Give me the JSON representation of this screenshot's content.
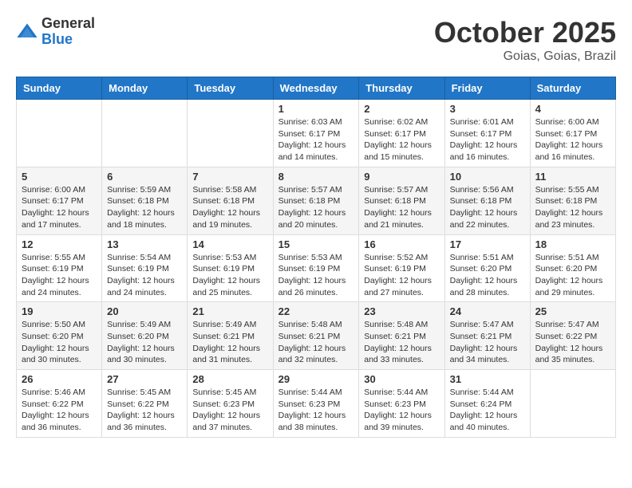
{
  "header": {
    "logo_general": "General",
    "logo_blue": "Blue",
    "title": "October 2025",
    "subtitle": "Goias, Goias, Brazil"
  },
  "weekdays": [
    "Sunday",
    "Monday",
    "Tuesday",
    "Wednesday",
    "Thursday",
    "Friday",
    "Saturday"
  ],
  "weeks": [
    [
      {
        "day": "",
        "info": ""
      },
      {
        "day": "",
        "info": ""
      },
      {
        "day": "",
        "info": ""
      },
      {
        "day": "1",
        "info": "Sunrise: 6:03 AM\nSunset: 6:17 PM\nDaylight: 12 hours\nand 14 minutes."
      },
      {
        "day": "2",
        "info": "Sunrise: 6:02 AM\nSunset: 6:17 PM\nDaylight: 12 hours\nand 15 minutes."
      },
      {
        "day": "3",
        "info": "Sunrise: 6:01 AM\nSunset: 6:17 PM\nDaylight: 12 hours\nand 16 minutes."
      },
      {
        "day": "4",
        "info": "Sunrise: 6:00 AM\nSunset: 6:17 PM\nDaylight: 12 hours\nand 16 minutes."
      }
    ],
    [
      {
        "day": "5",
        "info": "Sunrise: 6:00 AM\nSunset: 6:17 PM\nDaylight: 12 hours\nand 17 minutes."
      },
      {
        "day": "6",
        "info": "Sunrise: 5:59 AM\nSunset: 6:18 PM\nDaylight: 12 hours\nand 18 minutes."
      },
      {
        "day": "7",
        "info": "Sunrise: 5:58 AM\nSunset: 6:18 PM\nDaylight: 12 hours\nand 19 minutes."
      },
      {
        "day": "8",
        "info": "Sunrise: 5:57 AM\nSunset: 6:18 PM\nDaylight: 12 hours\nand 20 minutes."
      },
      {
        "day": "9",
        "info": "Sunrise: 5:57 AM\nSunset: 6:18 PM\nDaylight: 12 hours\nand 21 minutes."
      },
      {
        "day": "10",
        "info": "Sunrise: 5:56 AM\nSunset: 6:18 PM\nDaylight: 12 hours\nand 22 minutes."
      },
      {
        "day": "11",
        "info": "Sunrise: 5:55 AM\nSunset: 6:18 PM\nDaylight: 12 hours\nand 23 minutes."
      }
    ],
    [
      {
        "day": "12",
        "info": "Sunrise: 5:55 AM\nSunset: 6:19 PM\nDaylight: 12 hours\nand 24 minutes."
      },
      {
        "day": "13",
        "info": "Sunrise: 5:54 AM\nSunset: 6:19 PM\nDaylight: 12 hours\nand 24 minutes."
      },
      {
        "day": "14",
        "info": "Sunrise: 5:53 AM\nSunset: 6:19 PM\nDaylight: 12 hours\nand 25 minutes."
      },
      {
        "day": "15",
        "info": "Sunrise: 5:53 AM\nSunset: 6:19 PM\nDaylight: 12 hours\nand 26 minutes."
      },
      {
        "day": "16",
        "info": "Sunrise: 5:52 AM\nSunset: 6:19 PM\nDaylight: 12 hours\nand 27 minutes."
      },
      {
        "day": "17",
        "info": "Sunrise: 5:51 AM\nSunset: 6:20 PM\nDaylight: 12 hours\nand 28 minutes."
      },
      {
        "day": "18",
        "info": "Sunrise: 5:51 AM\nSunset: 6:20 PM\nDaylight: 12 hours\nand 29 minutes."
      }
    ],
    [
      {
        "day": "19",
        "info": "Sunrise: 5:50 AM\nSunset: 6:20 PM\nDaylight: 12 hours\nand 30 minutes."
      },
      {
        "day": "20",
        "info": "Sunrise: 5:49 AM\nSunset: 6:20 PM\nDaylight: 12 hours\nand 30 minutes."
      },
      {
        "day": "21",
        "info": "Sunrise: 5:49 AM\nSunset: 6:21 PM\nDaylight: 12 hours\nand 31 minutes."
      },
      {
        "day": "22",
        "info": "Sunrise: 5:48 AM\nSunset: 6:21 PM\nDaylight: 12 hours\nand 32 minutes."
      },
      {
        "day": "23",
        "info": "Sunrise: 5:48 AM\nSunset: 6:21 PM\nDaylight: 12 hours\nand 33 minutes."
      },
      {
        "day": "24",
        "info": "Sunrise: 5:47 AM\nSunset: 6:21 PM\nDaylight: 12 hours\nand 34 minutes."
      },
      {
        "day": "25",
        "info": "Sunrise: 5:47 AM\nSunset: 6:22 PM\nDaylight: 12 hours\nand 35 minutes."
      }
    ],
    [
      {
        "day": "26",
        "info": "Sunrise: 5:46 AM\nSunset: 6:22 PM\nDaylight: 12 hours\nand 36 minutes."
      },
      {
        "day": "27",
        "info": "Sunrise: 5:45 AM\nSunset: 6:22 PM\nDaylight: 12 hours\nand 36 minutes."
      },
      {
        "day": "28",
        "info": "Sunrise: 5:45 AM\nSunset: 6:23 PM\nDaylight: 12 hours\nand 37 minutes."
      },
      {
        "day": "29",
        "info": "Sunrise: 5:44 AM\nSunset: 6:23 PM\nDaylight: 12 hours\nand 38 minutes."
      },
      {
        "day": "30",
        "info": "Sunrise: 5:44 AM\nSunset: 6:23 PM\nDaylight: 12 hours\nand 39 minutes."
      },
      {
        "day": "31",
        "info": "Sunrise: 5:44 AM\nSunset: 6:24 PM\nDaylight: 12 hours\nand 40 minutes."
      },
      {
        "day": "",
        "info": ""
      }
    ]
  ]
}
